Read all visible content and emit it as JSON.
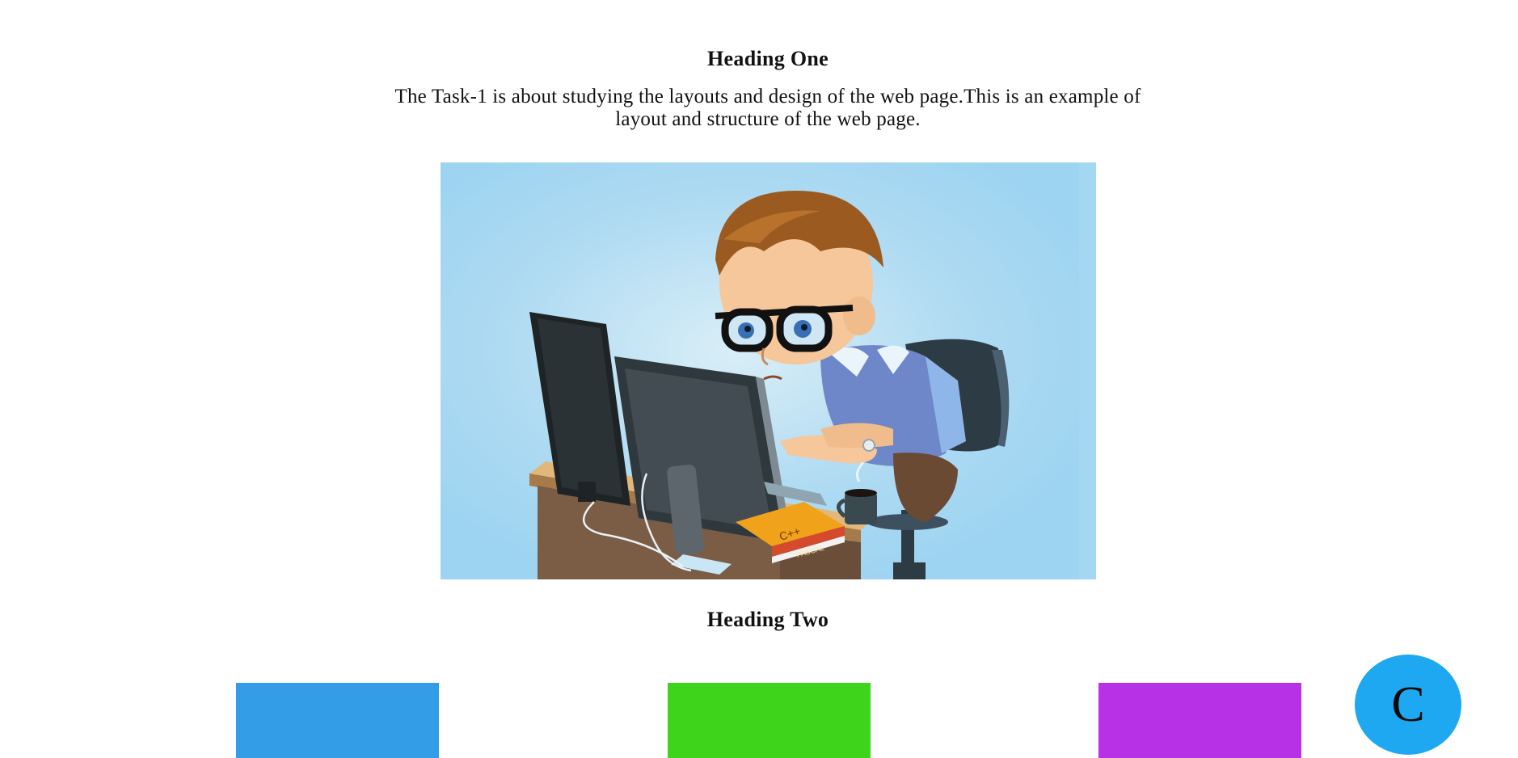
{
  "section1": {
    "heading": "Heading One",
    "paragraph": "The Task-1 is about studying the layouts and design of the web page.This is an example of layout and structure of the web page."
  },
  "hero_image": {
    "subject": "cartoon-programmer-at-computer",
    "book_labels": [
      "C++",
      "PASCAL"
    ]
  },
  "section2": {
    "heading": "Heading Two"
  },
  "boxes": [
    {
      "color": "#339de8"
    },
    {
      "color": "#3fd41c"
    },
    {
      "color": "#b732e6"
    }
  ],
  "fab": {
    "label": "C",
    "color": "#1ea8f1"
  }
}
